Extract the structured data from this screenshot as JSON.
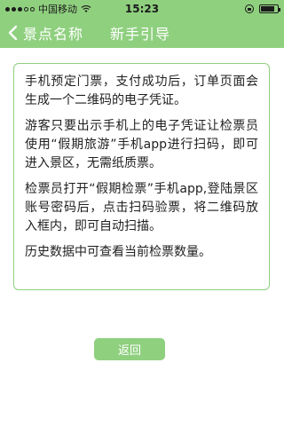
{
  "status_bar": {
    "carrier": "中国移动",
    "time": "15:23"
  },
  "nav": {
    "back_label": "景点名称",
    "title": "新手引导"
  },
  "guide": {
    "paragraphs": [
      "手机预定门票，支付成功后，订单页面会生成一个二维码的电子凭证。",
      "游客只要出示手机上的电子凭证让检票员使用“假期旅游”手机app进行扫码，即可进入景区，无需纸质票。",
      "检票员打开“假期检票”手机app,登陆景区账号密码后，点击扫码验票，将二维码放入框内，即可自动扫描。",
      "历史数据中可查看当前检票数量。"
    ]
  },
  "return_button": {
    "label": "返回"
  },
  "colors": {
    "accent": "#8fd07f"
  }
}
